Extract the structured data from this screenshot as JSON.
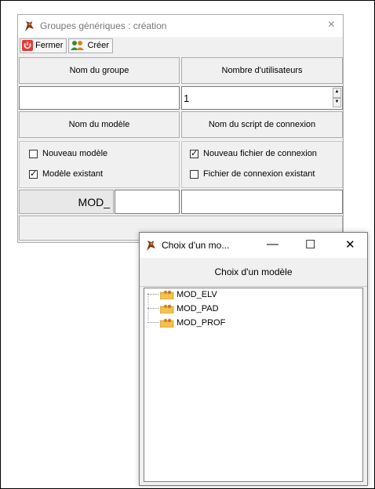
{
  "main_window": {
    "title": "Groupes génériques : création",
    "close_glyph": "×",
    "toolbar": {
      "close_label": "Fermer",
      "create_label": "Créer"
    },
    "headers": {
      "group_name": "Nom du groupe",
      "user_count": "Nombre d'utilisateurs",
      "model_name": "Nom du modèle",
      "script_name": "Nom du script de connexion"
    },
    "fields": {
      "group_name_value": "",
      "user_count_value": "1",
      "model_prefix": "MOD_",
      "model_suffix_value": "",
      "script_value": ""
    },
    "options_model": [
      {
        "label": "Nouveau modèle",
        "checked": false
      },
      {
        "label": "Modèle existant",
        "checked": true
      }
    ],
    "options_script": [
      {
        "label": "Nouveau fichier de connexion",
        "checked": true
      },
      {
        "label": "Fichier de connexion existant",
        "checked": false
      }
    ]
  },
  "child_window": {
    "title": "Choix d'un mo...",
    "minimize_glyph": "—",
    "maximize_glyph": "☐",
    "close_glyph": "✕",
    "header": "Choix d'un modèle",
    "tree_items": [
      "MOD_ELV",
      "MOD_PAD",
      "MOD_PROF"
    ]
  },
  "colors": {
    "window_bg": "#f0f0f0",
    "close_icon_red": "#e53935",
    "folder_yellow": "#f2c14e"
  }
}
